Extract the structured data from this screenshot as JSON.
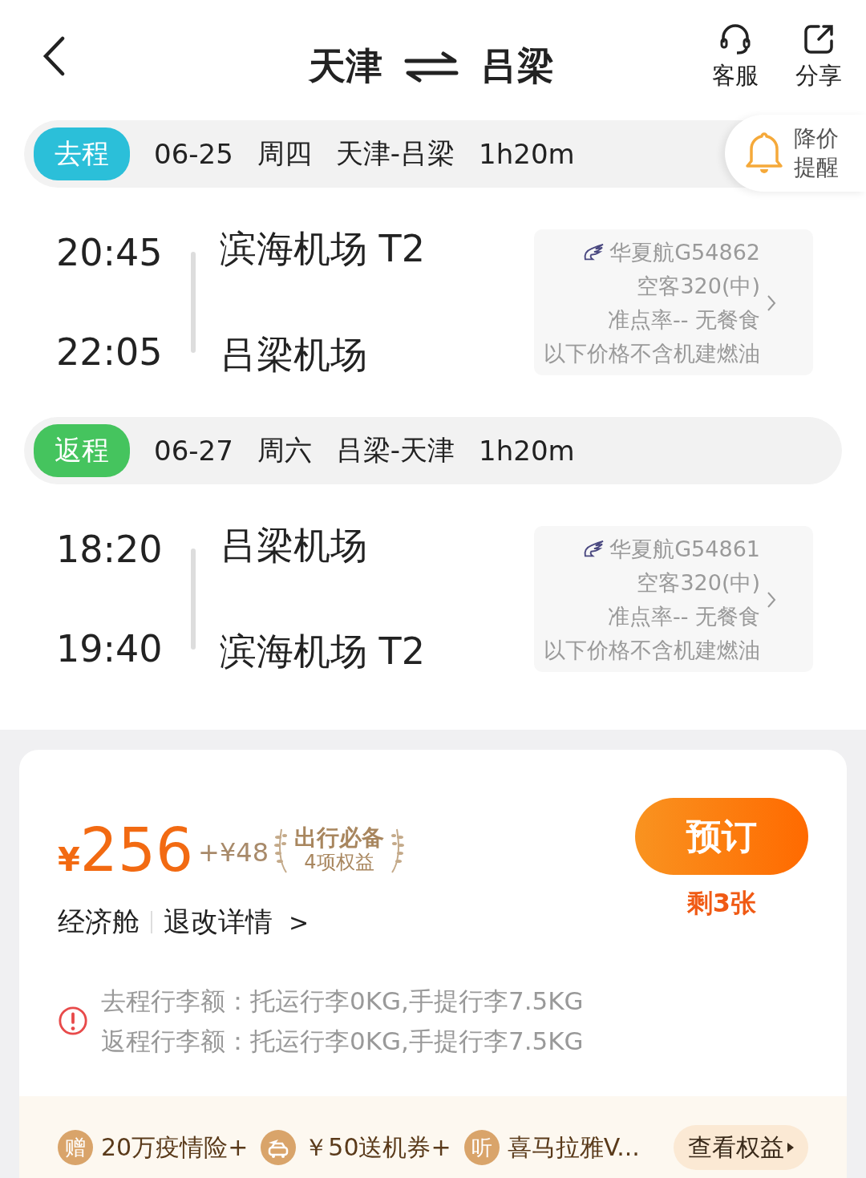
{
  "header": {
    "from": "天津",
    "to": "吕梁",
    "actions": [
      {
        "kind": "service",
        "label": "客服"
      },
      {
        "kind": "share",
        "label": "分享"
      }
    ]
  },
  "price_alert": {
    "line1": "降价",
    "line2": "提醒"
  },
  "legs": [
    {
      "tag": "去程",
      "color": "#2bbfd9",
      "date": "06-25",
      "weekday": "周四",
      "route": "天津-吕梁",
      "duration": "1h20m",
      "depart_time": "20:45",
      "depart_airport": "滨海机场 T2",
      "arrive_time": "22:05",
      "arrive_airport": "吕梁机场",
      "flight": "华夏航G54862",
      "aircraft": "空客320(中)",
      "punctuality": "准点率-- 无餐食",
      "note": "以下价格不含机建燃油"
    },
    {
      "tag": "返程",
      "color": "#45c45e",
      "date": "06-27",
      "weekday": "周六",
      "route": "吕梁-天津",
      "duration": "1h20m",
      "depart_time": "18:20",
      "depart_airport": "吕梁机场",
      "arrive_time": "19:40",
      "arrive_airport": "滨海机场 T2",
      "flight": "华夏航G54861",
      "aircraft": "空客320(中)",
      "punctuality": "准点率-- 无餐食",
      "note": "以下价格不含机建燃油"
    }
  ],
  "offer": {
    "currency": "¥",
    "price": "256",
    "extra": "+¥48",
    "perk_title": "出行必备",
    "perk_sub": "4项权益",
    "cabin": "经济舱",
    "refund_link": "退改详情",
    "refund_arrow": ">",
    "book_button": "预订",
    "remaining": "剩3张",
    "baggage": [
      "去程行李额：托运行李0KG,手提行李7.5KG",
      "返程行李额：托运行李0KG,手提行李7.5KG"
    ],
    "benefits": [
      {
        "kind": "char",
        "badge": "赠",
        "text": "20万疫情险+"
      },
      {
        "kind": "car",
        "text": "￥50送机券+"
      },
      {
        "kind": "char",
        "badge": "听",
        "text": "喜马拉雅V..."
      }
    ],
    "benefits_button": "查看权益"
  }
}
